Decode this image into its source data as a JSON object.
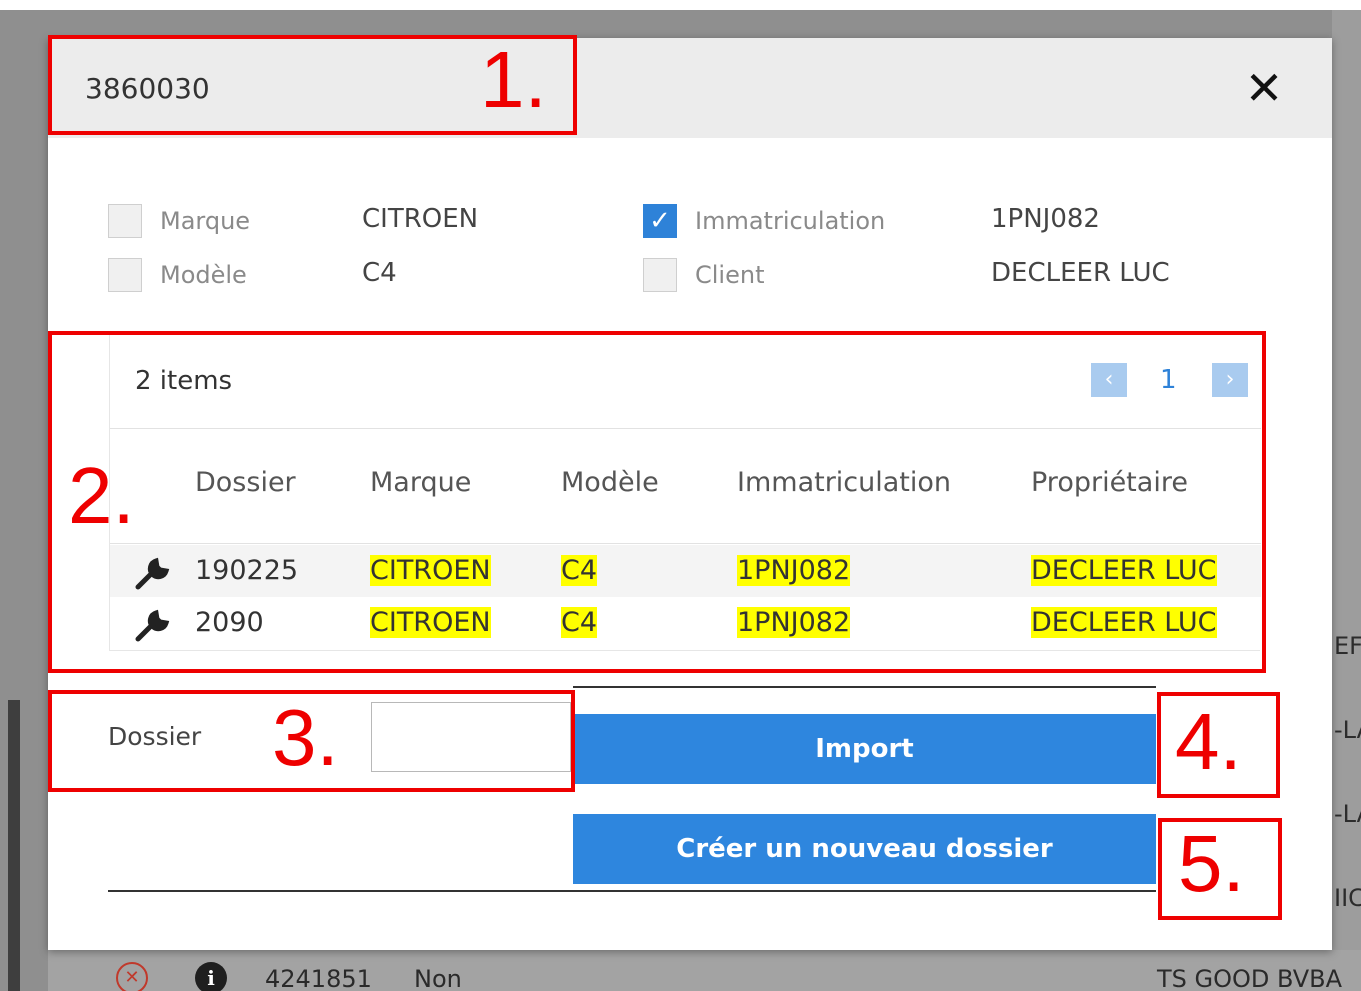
{
  "modal": {
    "title": "3860030",
    "close_symbol": "✕"
  },
  "filters": [
    {
      "label": "Marque",
      "value": "CITROEN",
      "checked": false
    },
    {
      "label": "Modèle",
      "value": "C4",
      "checked": false
    },
    {
      "label": "Immatriculation",
      "value": "1PNJ082",
      "checked": true
    },
    {
      "label": "Client",
      "value": "DECLEER LUC",
      "checked": false
    }
  ],
  "grid": {
    "items_count": "2 items",
    "page": "1",
    "prev_symbol": "‹",
    "next_symbol": "›",
    "columns": [
      "Dossier",
      "Marque",
      "Modèle",
      "Immatriculation",
      "Propriétaire"
    ],
    "rows": [
      {
        "icon": "wrench-icon",
        "dossier": "190225",
        "marque": "CITROEN",
        "modele": "C4",
        "immatriculation": "1PNJ082",
        "proprietaire": "DECLEER LUC"
      },
      {
        "icon": "wrench-icon",
        "dossier": "2090",
        "marque": "CITROEN",
        "modele": "C4",
        "immatriculation": "1PNJ082",
        "proprietaire": "DECLEER LUC"
      }
    ],
    "highlight_color": "#ffff00"
  },
  "form": {
    "dossier_label": "Dossier",
    "dossier_value": "",
    "import_label": "Import",
    "create_label": "Créer un nouveau dossier"
  },
  "annotations": [
    "1.",
    "2.",
    "3.",
    "4.",
    "5."
  ],
  "background": {
    "right_texts": [
      "EF",
      "-LA",
      "-LA",
      "IIC"
    ],
    "bottom_row": {
      "number": "4241851",
      "status": "Non",
      "company": "TS GOOD BVBA"
    }
  },
  "colors": {
    "accent": "#2e86de",
    "annotation": "#ee0000",
    "checkbox_checked": "#2e82d8"
  }
}
